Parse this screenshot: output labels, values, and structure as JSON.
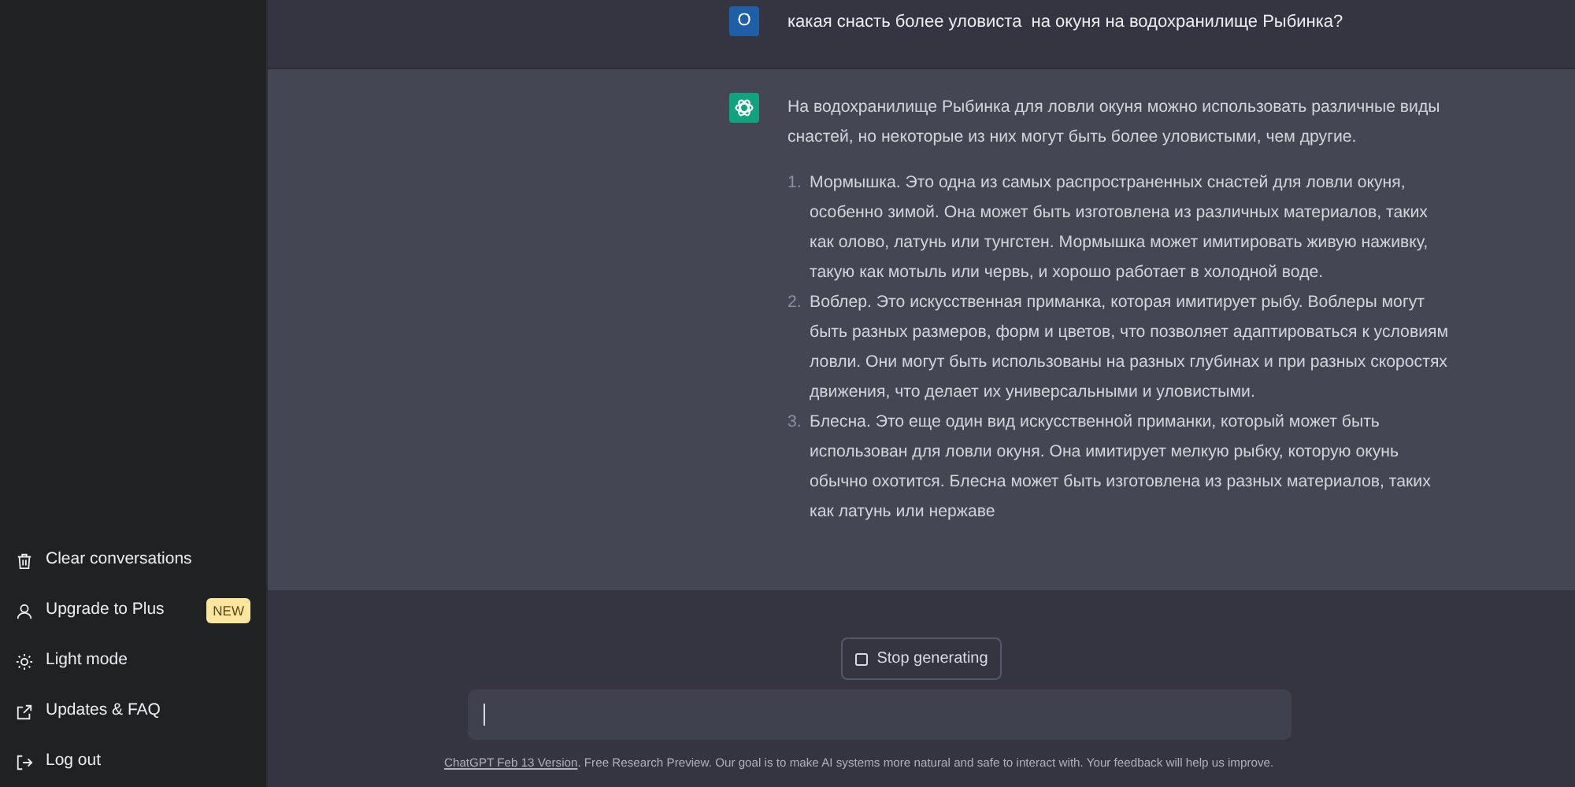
{
  "sidebar": {
    "items": [
      {
        "kind": "trash",
        "label": "Clear conversations"
      },
      {
        "kind": "user",
        "label": "Upgrade to Plus",
        "badge": "NEW"
      },
      {
        "kind": "sun",
        "label": "Light mode"
      },
      {
        "kind": "external",
        "label": "Updates & FAQ"
      },
      {
        "kind": "logout",
        "label": "Log out"
      }
    ]
  },
  "messages": [
    {
      "kind": "user",
      "avatar": "O",
      "text": "какая снасть более уловиста  на окуня на водохранилище Рыбинка?"
    },
    {
      "kind": "assistant",
      "intro": "На водохранилище Рыбинка для ловли окуня можно использовать различные виды снастей, но некоторые из них могут быть более уловистыми, чем другие.",
      "list": [
        {
          "number": "1.",
          "text": "Мормышка. Это одна из самых распространенных снастей для ловли окуня, особенно зимой. Она может быть изготовлена из различных материалов, таких как олово, латунь или тунгстен. Мормышка может имитировать живую наживку, такую как мотыль или червь, и хорошо работает в холодной воде."
        },
        {
          "number": "2.",
          "text": "Воблер. Это искусственная приманка, которая имитирует рыбу. Воблеры могут быть разных размеров, форм и цветов, что позволяет адаптироваться к условиям ловли. Они могут быть использованы на разных глубинах и при разных скоростях движения, что делает их универсальными и уловистыми."
        },
        {
          "number": "3.",
          "text": "Блесна. Это еще один вид искусственной приманки, который может быть использован для ловли окуня. Она имитирует мелкую рыбку, которую окунь обычно охотится. Блесна может быть изготовлена из разных материалов, таких как латунь или нержаве"
        }
      ]
    }
  ],
  "stop_button": {
    "label": "Stop generating"
  },
  "footer": {
    "link": "ChatGPT Feb 13 Version",
    "text": ". Free Research Preview. Our goal is to make AI systems more natural and safe to interact with. Your feedback will help us improve."
  }
}
